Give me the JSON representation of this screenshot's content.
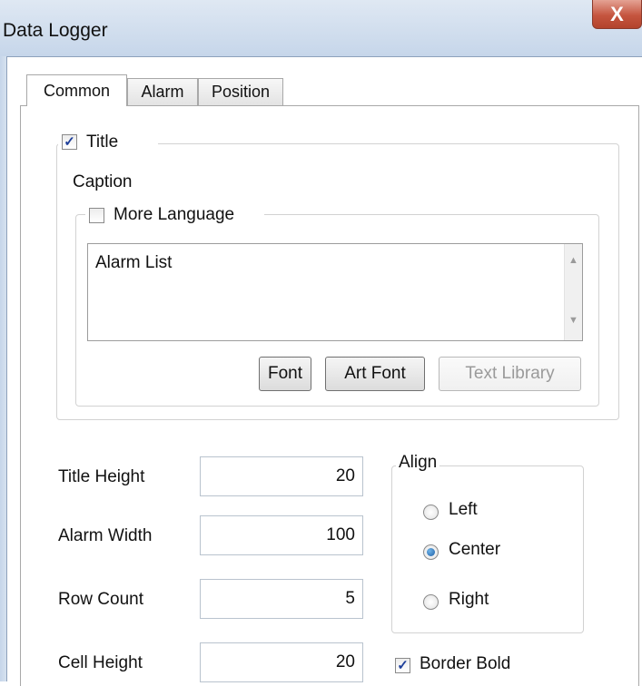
{
  "window": {
    "title": "Data Logger",
    "close_glyph": "X"
  },
  "tabs": [
    {
      "label": "Common",
      "active": true
    },
    {
      "label": "Alarm",
      "active": false
    },
    {
      "label": "Position",
      "active": false
    }
  ],
  "title_group": {
    "checkbox_label": "Title",
    "checked": true,
    "caption_label": "Caption",
    "more_language_label": "More Language",
    "more_language_checked": false,
    "caption_text": "Alarm List",
    "font_button": "Font",
    "art_font_button": "Art Font",
    "text_library_button": "Text Library"
  },
  "fields": {
    "title_height": {
      "label": "Title Height",
      "value": "20"
    },
    "alarm_width": {
      "label": "Alarm Width",
      "value": "100"
    },
    "row_count": {
      "label": "Row Count",
      "value": "5"
    },
    "cell_height": {
      "label": "Cell Height",
      "value": "20"
    }
  },
  "align": {
    "legend": "Align",
    "options": [
      "Left",
      "Center",
      "Right"
    ],
    "selected": "Center"
  },
  "border_bold": {
    "label": "Border Bold",
    "checked": true
  },
  "icons": {
    "check": "✓",
    "scroll_up": "▲",
    "scroll_down": "▼"
  },
  "colors": {
    "titlebar": "#c6d6ea",
    "close_button": "#c5553f",
    "radio_selected": "#1f5fa6"
  }
}
